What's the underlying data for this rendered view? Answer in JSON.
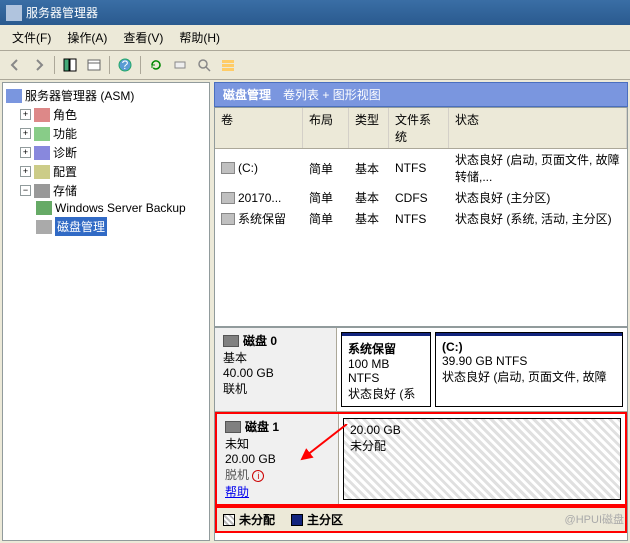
{
  "window": {
    "title": "服务器管理器"
  },
  "menu": {
    "file": "文件(F)",
    "action": "操作(A)",
    "view": "查看(V)",
    "help": "帮助(H)"
  },
  "tree": {
    "root": "服务器管理器 (ASM)",
    "roles": "角色",
    "features": "功能",
    "diagnostics": "诊断",
    "config": "配置",
    "storage": "存储",
    "wsb": "Windows Server Backup",
    "diskmgmt": "磁盘管理"
  },
  "header": {
    "title": "磁盘管理",
    "subtitle": "卷列表 + 图形视图"
  },
  "volcols": {
    "vol": "卷",
    "layout": "布局",
    "type": "类型",
    "fs": "文件系统",
    "status": "状态"
  },
  "volumes": [
    {
      "name": "(C:)",
      "layout": "简单",
      "type": "基本",
      "fs": "NTFS",
      "status": "状态良好 (启动, 页面文件, 故障转储,..."
    },
    {
      "name": "20170...",
      "layout": "简单",
      "type": "基本",
      "fs": "CDFS",
      "status": "状态良好 (主分区)"
    },
    {
      "name": "系统保留",
      "layout": "简单",
      "type": "基本",
      "fs": "NTFS",
      "status": "状态良好 (系统, 活动, 主分区)"
    }
  ],
  "disk0": {
    "label": "磁盘 0",
    "type": "基本",
    "size": "40.00 GB",
    "status": "联机",
    "p1": {
      "name": "系统保留",
      "size": "100 MB NTFS",
      "st": "状态良好 (系"
    },
    "p2": {
      "name": "(C:)",
      "size": "39.90 GB NTFS",
      "st": "状态良好 (启动, 页面文件, 故障"
    }
  },
  "disk1": {
    "label": "磁盘 1",
    "type": "未知",
    "size": "20.00 GB",
    "status": "脱机",
    "help": "帮助",
    "p1": {
      "size": "20.00 GB",
      "st": "未分配"
    }
  },
  "legend": {
    "unalloc": "未分配",
    "primary": "主分区"
  },
  "watermark": "@HPUI磁盘"
}
